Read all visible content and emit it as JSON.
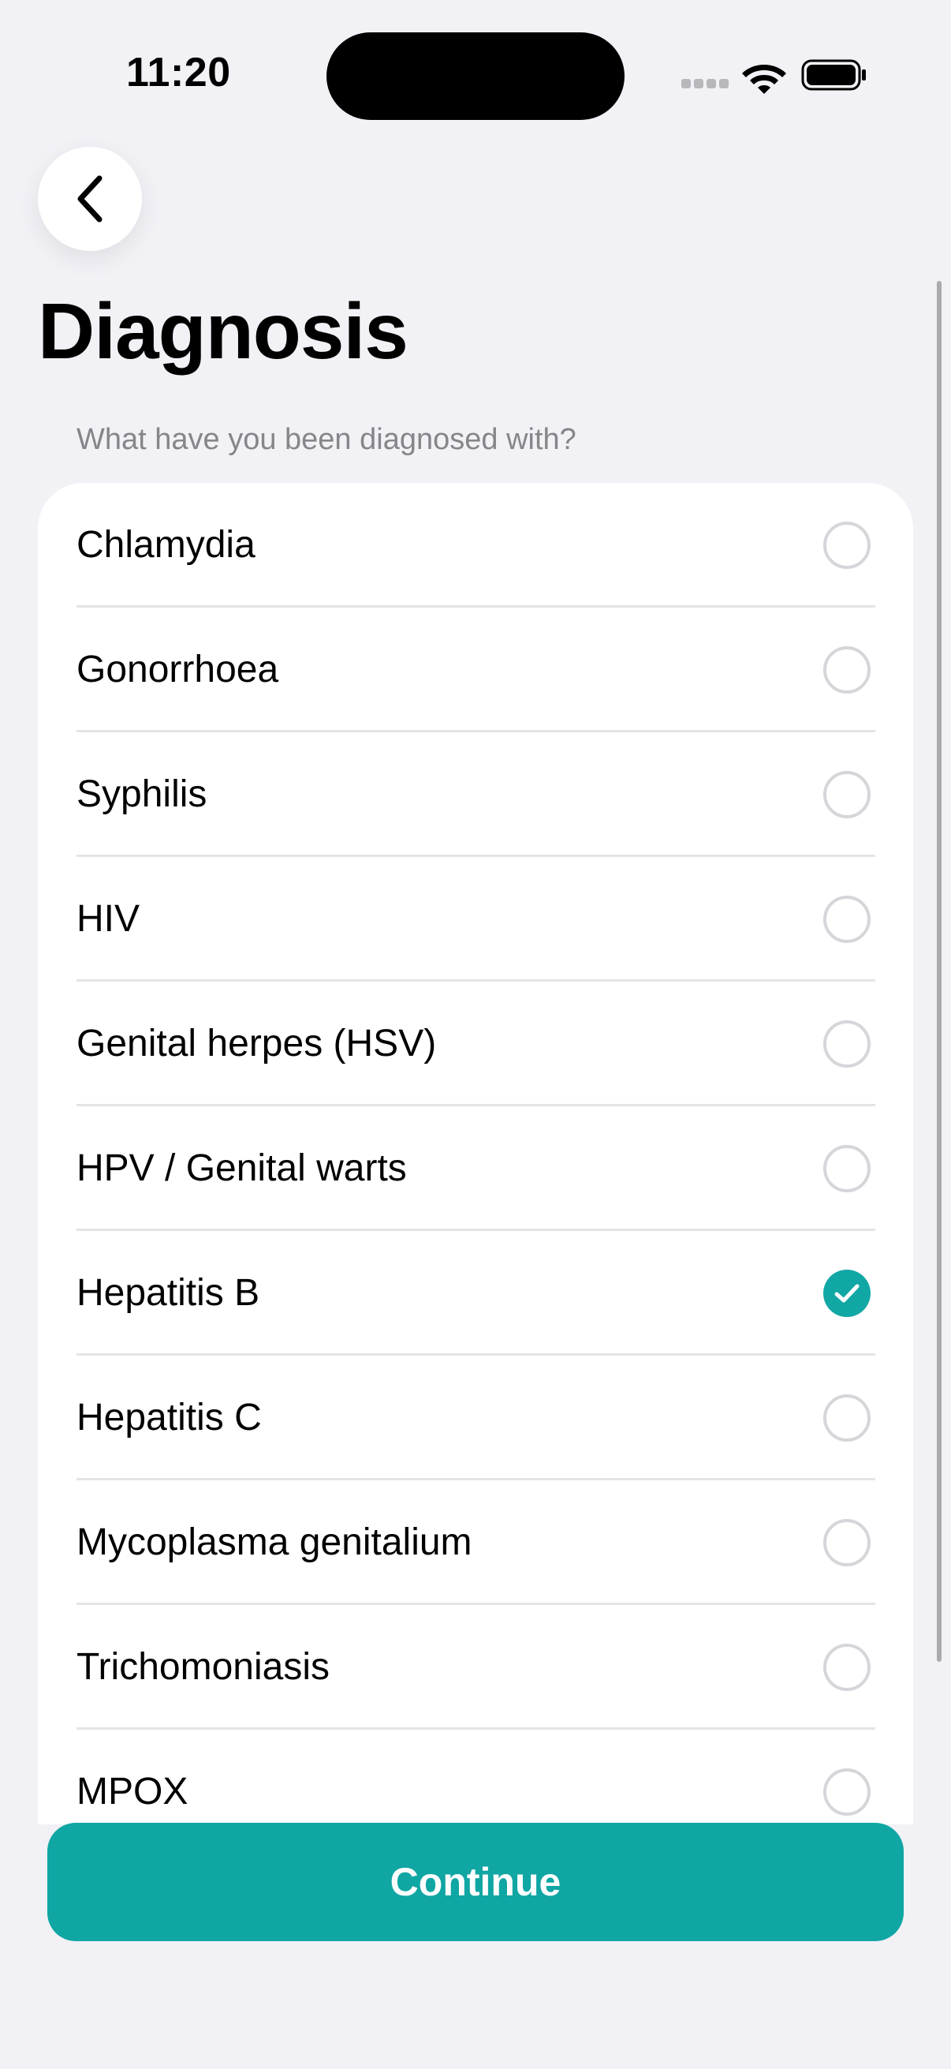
{
  "status_bar": {
    "time": "11:20"
  },
  "header": {
    "title": "Diagnosis",
    "subtitle": "What have you been diagnosed with?",
    "back_icon": "chevron-left-icon"
  },
  "diagnoses": [
    {
      "label": "Chlamydia",
      "selected": false
    },
    {
      "label": "Gonorrhoea",
      "selected": false
    },
    {
      "label": "Syphilis",
      "selected": false
    },
    {
      "label": "HIV",
      "selected": false
    },
    {
      "label": "Genital herpes (HSV)",
      "selected": false
    },
    {
      "label": "HPV / Genital warts",
      "selected": false
    },
    {
      "label": "Hepatitis B",
      "selected": true
    },
    {
      "label": "Hepatitis C",
      "selected": false
    },
    {
      "label": "Mycoplasma genitalium",
      "selected": false
    },
    {
      "label": "Trichomoniasis",
      "selected": false
    },
    {
      "label": "MPOX",
      "selected": false
    }
  ],
  "actions": {
    "continue_label": "Continue"
  },
  "colors": {
    "accent": "#0FA6A3",
    "background": "#F1F1F6",
    "card": "#FFFFFF",
    "subtitle_text": "#85858A"
  }
}
